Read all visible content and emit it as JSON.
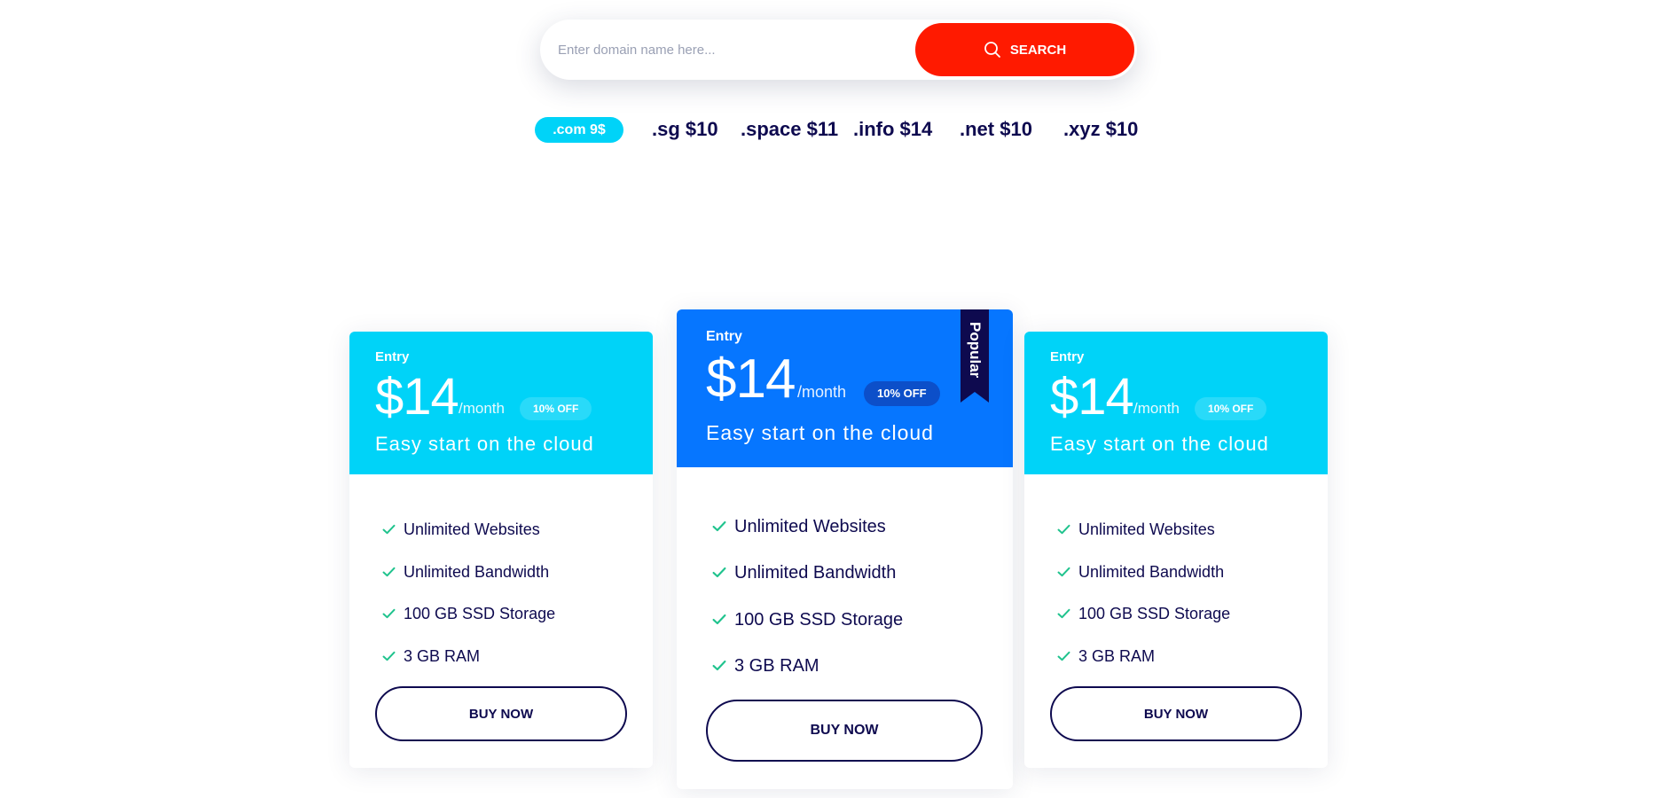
{
  "search": {
    "placeholder": "Enter domain name here...",
    "button_label": "SEARCH",
    "button_color": "#ff1a00"
  },
  "tlds": [
    {
      "label": ".com 9$",
      "active": true
    },
    {
      "label": ".sg $10",
      "active": false
    },
    {
      "label": ".space $11",
      "active": false
    },
    {
      "label": ".info $14",
      "active": false
    },
    {
      "label": ".net $10",
      "active": false
    },
    {
      "label": ".xyz $10",
      "active": false
    }
  ],
  "colors": {
    "accent_cyan": "#00d3f8",
    "accent_blue": "#0676ff",
    "ribbon": "#0e0a4f",
    "text_dark": "#0e0a4f",
    "check": "#1fc38d"
  },
  "plans": [
    {
      "tier": "Entry",
      "price": "$14",
      "period": "/month",
      "badge": "10% OFF",
      "tagline": "Easy start on the cloud",
      "features": [
        "Unlimited Websites",
        "Unlimited Bandwidth",
        "100 GB SSD Storage",
        "3 GB RAM"
      ],
      "button_label": "BUY NOW"
    },
    {
      "tier": "Entry",
      "price": "$14",
      "period": "/month",
      "badge": "10% OFF",
      "tagline": "Easy start on the cloud",
      "ribbon": "Popular",
      "features": [
        "Unlimited Websites",
        "Unlimited Bandwidth",
        "100 GB SSD Storage",
        "3 GB RAM"
      ],
      "button_label": "BUY NOW"
    },
    {
      "tier": "Entry",
      "price": "$14",
      "period": "/month",
      "badge": "10% OFF",
      "tagline": "Easy start on the cloud",
      "features": [
        "Unlimited Websites",
        "Unlimited Bandwidth",
        "100 GB SSD Storage",
        "3 GB RAM"
      ],
      "button_label": "BUY NOW"
    }
  ]
}
